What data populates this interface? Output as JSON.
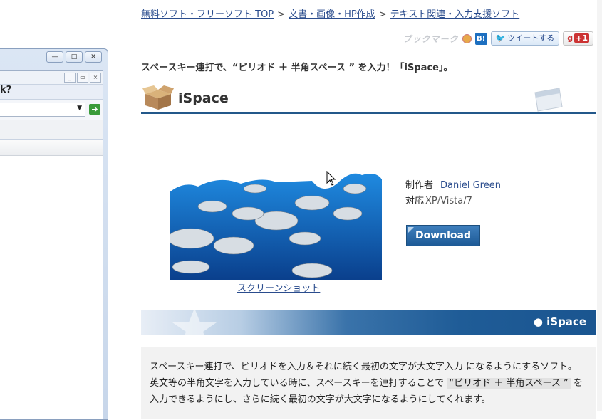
{
  "left_window": {
    "title_controls": [
      "—",
      "□",
      "✕"
    ],
    "mdi_controls": [
      "_",
      "▭",
      "×"
    ],
    "menu_fragment": "k?"
  },
  "breadcrumb": {
    "items": [
      "無料ソフト・フリーソフト TOP",
      "文書・画像・HP作成",
      "テキスト関連・入力支援ソフト"
    ],
    "separator": ">"
  },
  "social": {
    "bookmark_label": "ブックマーク",
    "hatena_label": "B!",
    "tweet_label": "ツイートする",
    "gplus_label": "+1"
  },
  "tagline": "スペースキー連打で、“ピリオド ＋ 半角スペース ” を入力！「iSpace」。",
  "app": {
    "title": "iSpace",
    "screenshot_caption": "スクリーンショット",
    "author_label": "制作者",
    "author_name": "Daniel Green",
    "os_label": "対応",
    "os_value": "XP/Vista/7",
    "download_label": "Download"
  },
  "section_band": {
    "label": "● iSpace"
  },
  "description": {
    "line1": "スペースキー連打で、ピリオドを入力＆それに続く最初の文字が大文字入力 になるようにするソフト。",
    "line2_a": "英文等の半角文字を入力している時に、スペースキーを連打することで ",
    "line2_hl": "“ピリオド ＋ 半角スペース ”",
    "line2_b": " を",
    "line3": "入力できるようにし、さらに続く最初の文字が大文字になるようにしてくれます。"
  },
  "colors": {
    "accent": "#23588a",
    "link": "#2a4c8d",
    "band": "#1f5c97"
  }
}
